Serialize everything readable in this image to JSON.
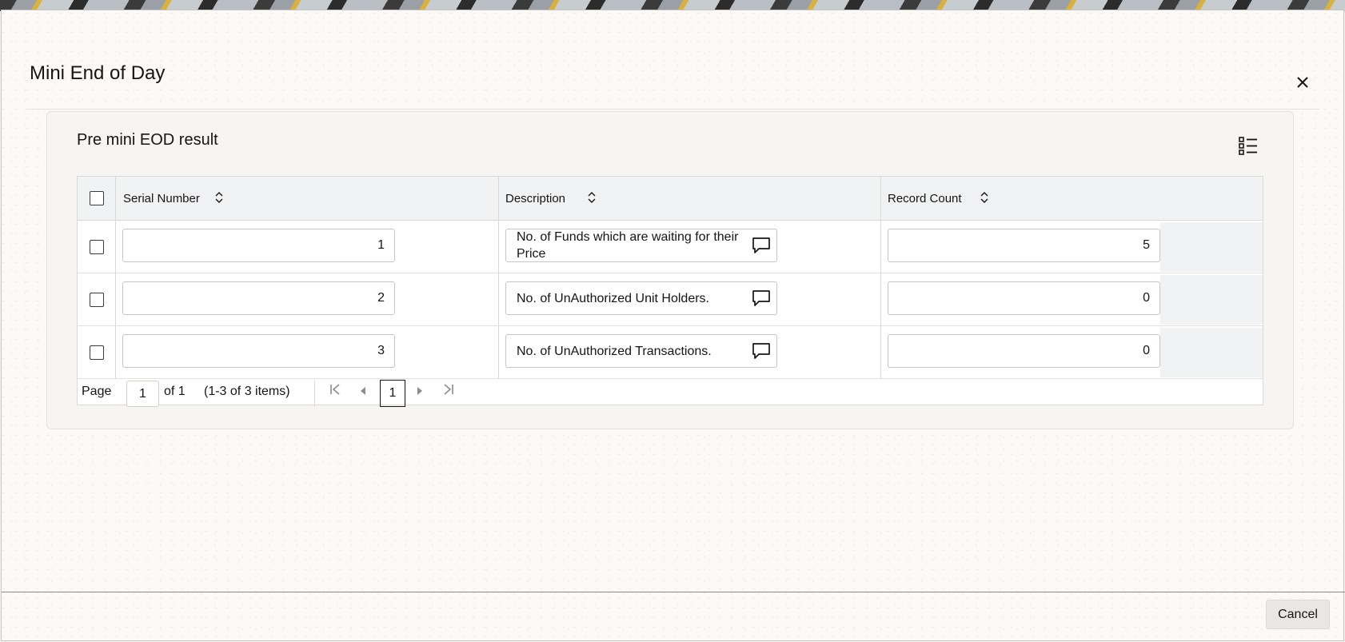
{
  "dialog": {
    "title": "Mini End of Day",
    "close_icon": "close-icon",
    "cancel_label": "Cancel"
  },
  "panel": {
    "title": "Pre mini EOD result",
    "view_icon": "list-view-icon"
  },
  "grid": {
    "columns": [
      {
        "label": "Serial Number"
      },
      {
        "label": "Description"
      },
      {
        "label": "Record Count"
      }
    ],
    "rows": [
      {
        "serial": "1",
        "description": "No. of Funds which are waiting for their Price",
        "count": "5"
      },
      {
        "serial": "2",
        "description": "No. of UnAuthorized Unit Holders.",
        "count": "0"
      },
      {
        "serial": "3",
        "description": "No. of UnAuthorized Transactions.",
        "count": "0"
      }
    ]
  },
  "pager": {
    "page_label": "Page",
    "page_value": "1",
    "of_label": "of 1",
    "items_label": "(1-3 of 3 items)",
    "current_page": "1"
  }
}
